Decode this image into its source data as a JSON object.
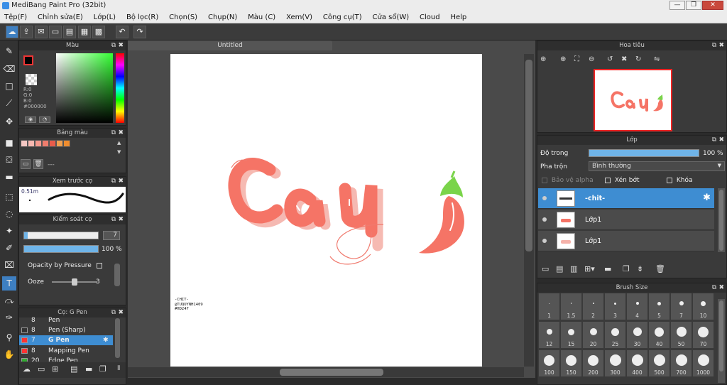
{
  "window": {
    "title": "MediBang Paint Pro (32bit)",
    "controls": [
      "—",
      "❐",
      "✕"
    ]
  },
  "menu": [
    "Tệp(F)",
    "Chỉnh sửa(E)",
    "Lớp(L)",
    "Bộ lọc(R)",
    "Chọn(S)",
    "Chụp(N)",
    "Màu (C)",
    "Xem(V)",
    "Công cụ(T)",
    "Cửa sổ(W)",
    "Cloud",
    "Help"
  ],
  "document": {
    "tab": "Untitled"
  },
  "panels": {
    "color": {
      "title": "Màu",
      "r": "R:0",
      "g": "G:0",
      "b": "B:0",
      "hex": "#000000"
    },
    "palette": {
      "title": "Bảng màu",
      "placeholder": "---",
      "swatches": [
        "#f4c7c3",
        "#f8b8b0",
        "#f59a8e",
        "#ef7d6d",
        "#e85c4a",
        "#f0a050",
        "#f08d2e"
      ]
    },
    "brush_preview": {
      "title": "Xem trước cọ",
      "size": "0.51m"
    },
    "brush_control": {
      "title": "Kiểm soát cọ",
      "size_value": "7",
      "opacity_value": "100 %",
      "opacity_by_pressure": "Opacity by Pressure",
      "ooze_label": "Ooze",
      "ooze_value": "3",
      "size_level": 0.05,
      "opacity_level": 1.0
    },
    "brush_list": {
      "title": "Cọ: G Pen",
      "items": [
        {
          "num": "8",
          "name": "Pen",
          "color": "#ff4040"
        },
        {
          "num": "8",
          "name": "Pen (Sharp)",
          "color": "#333333"
        },
        {
          "num": "7",
          "name": "G Pen",
          "color": "#ff3333"
        },
        {
          "num": "8",
          "name": "Mapping Pen",
          "color": "#ff3333"
        },
        {
          "num": "20",
          "name": "Edge Pen",
          "color": "#33aa33"
        }
      ]
    },
    "navigator": {
      "title": "Hoa tiêu"
    },
    "layers": {
      "title": "Lớp",
      "opacity_label": "Độ trong",
      "opacity_value": "100 %",
      "opacity_level": 1.0,
      "blend_label": "Pha trộn",
      "blend_value": "Bình thường",
      "protect_alpha": "Bảo vệ alpha",
      "clipping": "Xén bớt",
      "lock": "Khóa",
      "items": [
        {
          "name": "-chit-",
          "selected": true
        },
        {
          "name": "Lớp1",
          "selected": false
        },
        {
          "name": "Lớp1",
          "selected": false
        }
      ]
    },
    "brush_size": {
      "title": "Brush Size",
      "sizes": [
        "1",
        "1.5",
        "2",
        "3",
        "4",
        "5",
        "7",
        "10",
        "12",
        "15",
        "20",
        "25",
        "30",
        "40",
        "50",
        "70",
        "100",
        "150",
        "200",
        "300",
        "400",
        "500",
        "700",
        "1000"
      ]
    }
  },
  "canvas": {
    "signature": [
      "-CHIT-",
      "@TUQUYNH1409",
      "#HD247"
    ]
  },
  "colors": {
    "accent": "#3e8dd2",
    "panel": "#3a3a3a",
    "salmon": "#f07060"
  }
}
